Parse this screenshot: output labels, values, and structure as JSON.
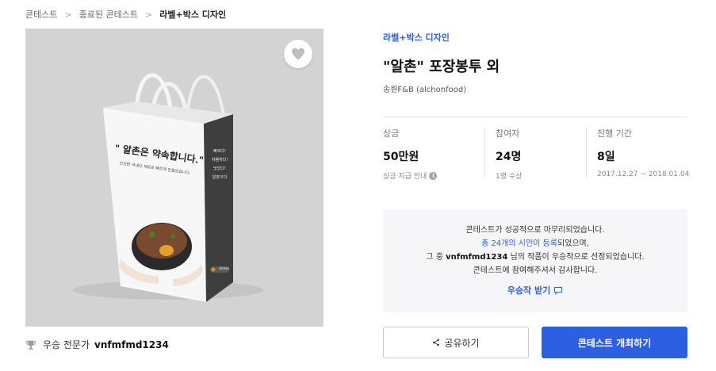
{
  "breadcrumb": {
    "items": [
      "콘테스트",
      "종료된 콘테스트",
      "라벨+박스 디자인"
    ]
  },
  "category": "라벨+박스 디자인",
  "title": "\"알촌\" 포장봉투 외",
  "company": "송원F&B (alchonfood)",
  "stats": [
    {
      "key": "상금",
      "value": "50만원",
      "sub": "상금 지급 안내"
    },
    {
      "key": "참여자",
      "value": "24명",
      "sub": "1명 수상"
    },
    {
      "key": "진행 기간",
      "value": "8일",
      "sub": "2017.12.27 ~ 2018.01.04"
    }
  ],
  "notice": {
    "line1": "콘테스트가 성공적으로 마무리되었습니다.",
    "line2_blue": "총 24개의 시안이 등록",
    "line2_rest": "되었으며,",
    "line3_pre": "그 중",
    "line3_name": "vnfmfmd1234",
    "line3_post": "님의 작품이 우승작으로 선정되었습니다.",
    "line4": "콘테스트에 참여해주셔서 감사합니다.",
    "link_label": "우승작 받기"
  },
  "winner": {
    "label": "우승 전문가",
    "name": "vnfmfmd1234"
  },
  "buttons": {
    "share": "공유하기",
    "host": "콘테스트 개최하기"
  },
  "product": {
    "bag_headline": "\" 알촌은 약속합니다.\"",
    "bag_subline": "신선한 국내산 재료로 빠르게 만들었습니다.",
    "bag_side_text": [
      "빠르다!",
      "저렴하다!",
      "맛있다!",
      "알촌이다"
    ],
    "bag_brand": "alchon"
  },
  "colors": {
    "accent": "#2d5fe3",
    "notice_bg": "#f6f6f8",
    "hero_bg": "#d3d3d3"
  }
}
